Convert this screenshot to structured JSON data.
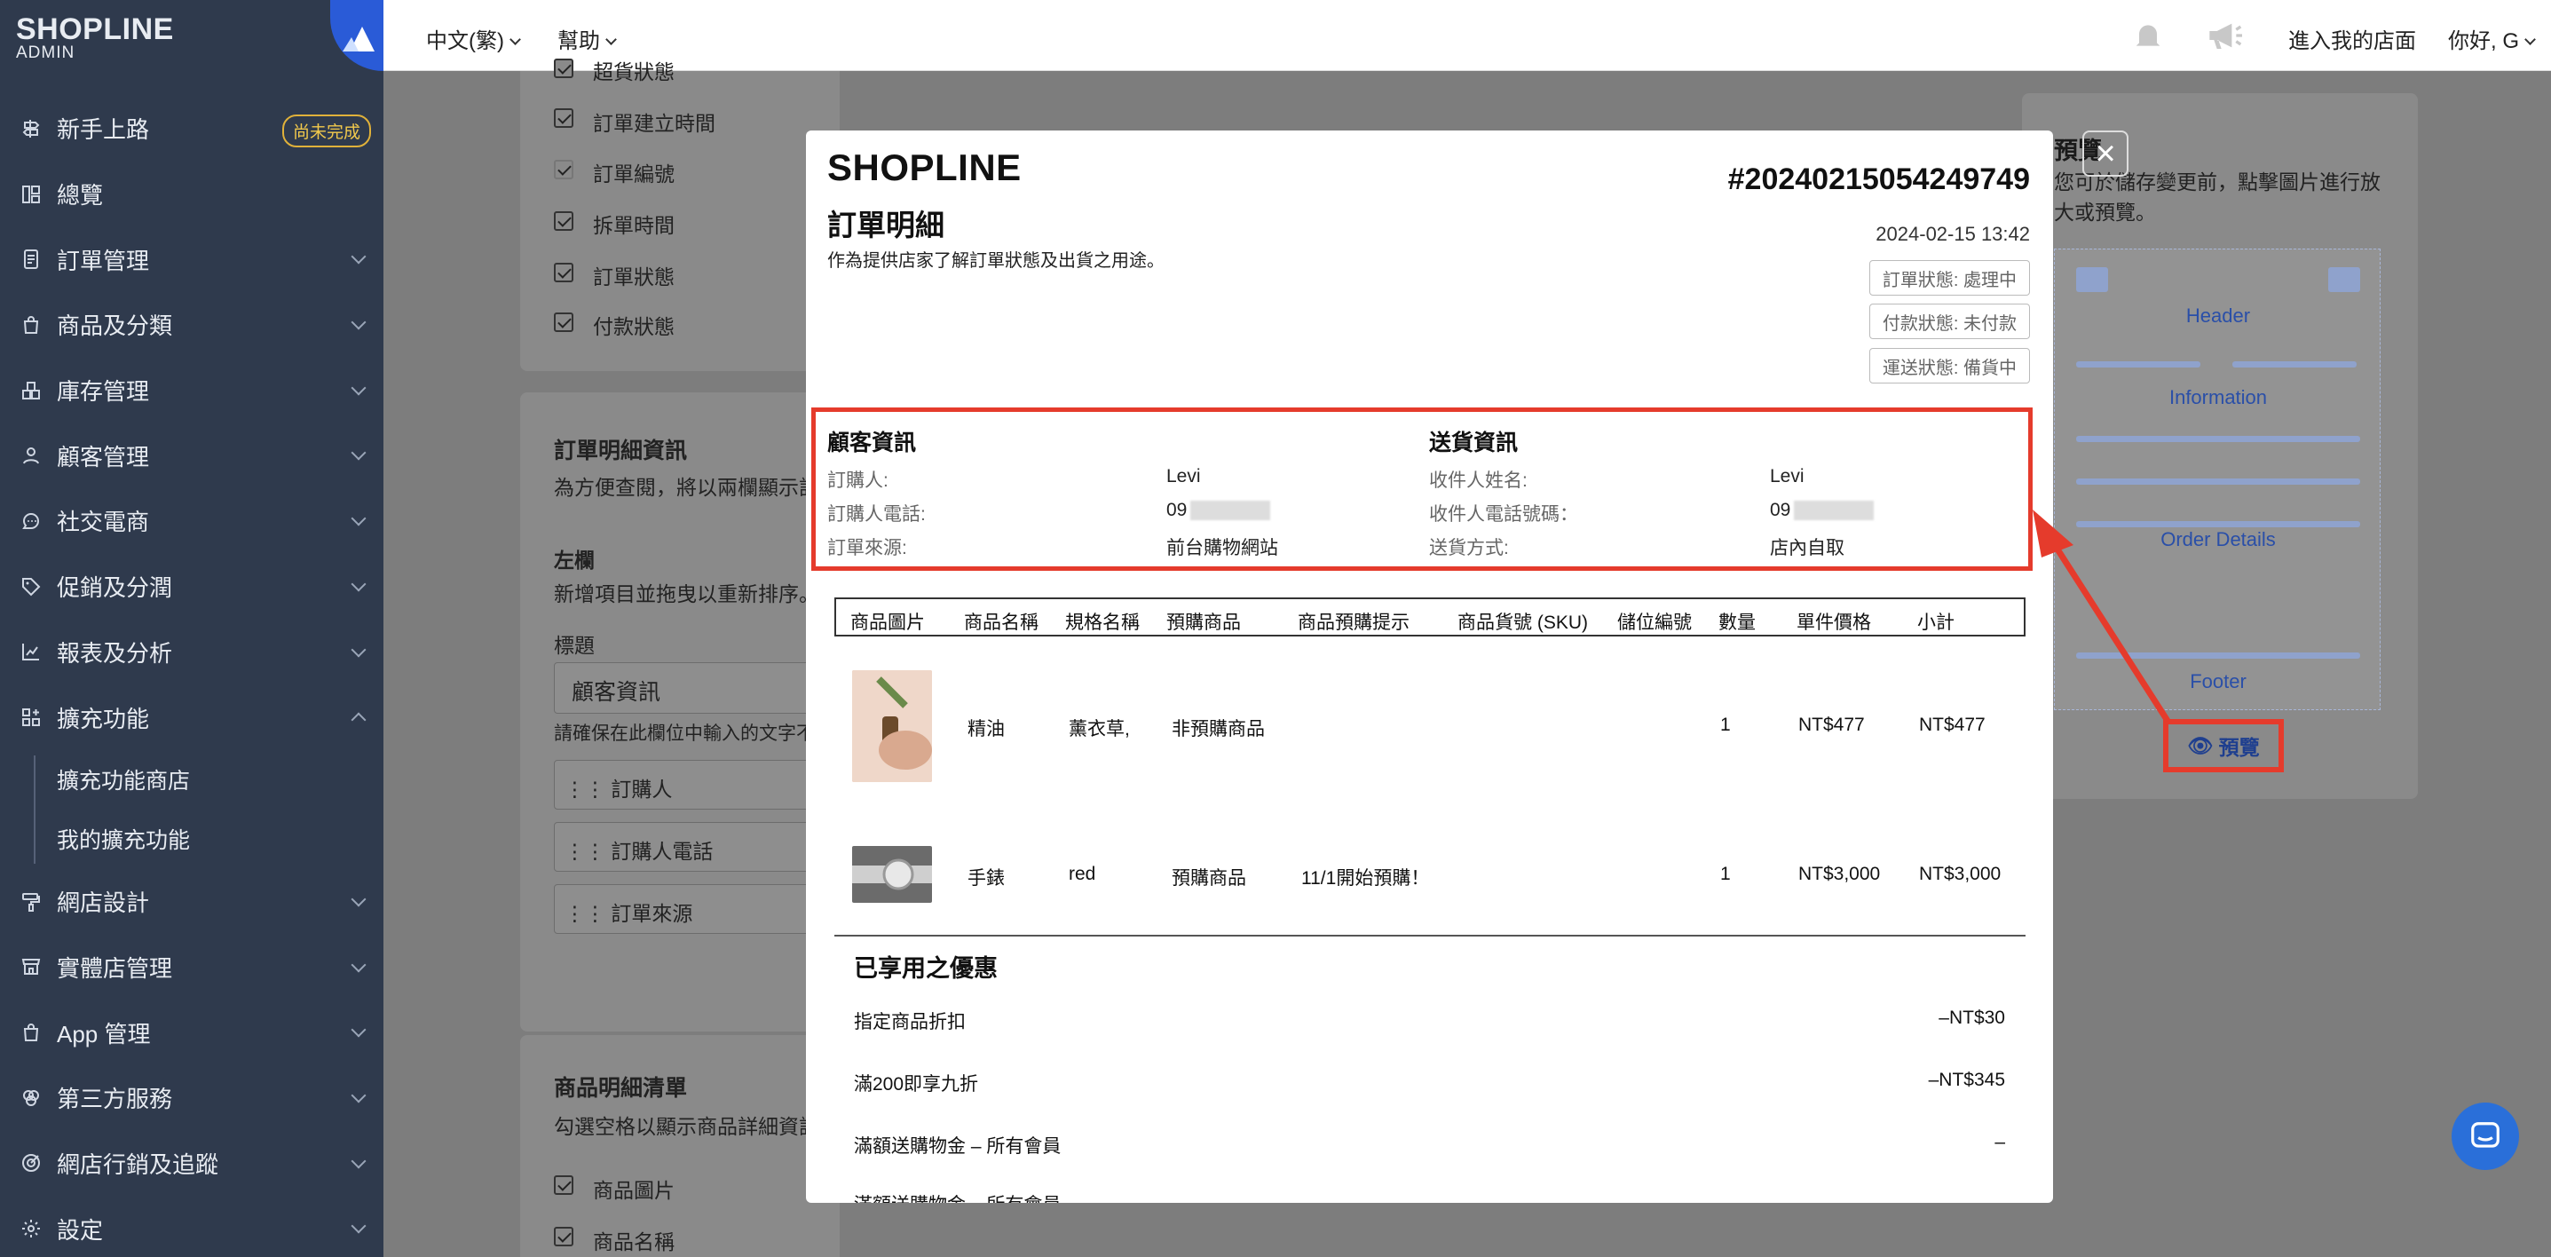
{
  "sidebar": {
    "brand": "SHOPLINE",
    "brand_sub": "ADMIN",
    "items": [
      {
        "label": "新手上路",
        "badge": "尚未完成"
      },
      {
        "label": "總覽"
      },
      {
        "label": "訂單管理"
      },
      {
        "label": "商品及分類"
      },
      {
        "label": "庫存管理"
      },
      {
        "label": "顧客管理"
      },
      {
        "label": "社交電商"
      },
      {
        "label": "促銷及分潤"
      },
      {
        "label": "報表及分析"
      },
      {
        "label": "擴充功能"
      }
    ],
    "subitems": [
      "擴充功能商店",
      "我的擴充功能"
    ],
    "items2": [
      {
        "label": "網店設計"
      },
      {
        "label": "實體店管理"
      },
      {
        "label": "App 管理"
      },
      {
        "label": "第三方服務"
      },
      {
        "label": "網店行銷及追蹤"
      },
      {
        "label": "設定"
      }
    ]
  },
  "topbar": {
    "language": "中文(繁)",
    "help": "幫助",
    "enter_store": "進入我的店面",
    "greeting": "你好, G"
  },
  "background": {
    "checks_top": [
      "超貨狀態",
      "訂單建立時間",
      "訂單編號",
      "拆單時間",
      "訂單狀態",
      "付款狀態"
    ],
    "detail_section_title": "訂單明細資訊",
    "detail_section_desc": "為方便查閱，將以兩欄顯示訂",
    "left_col": "左欄",
    "left_col_desc": "新增項目並拖曳以重新排序。",
    "label_title": "標題",
    "title_value": "顧客資訊",
    "hint": "請確保在此欄位中輸入的文字不",
    "drag_items": [
      "訂購人",
      "訂購人電話",
      "訂單來源"
    ],
    "product_section_title": "商品明細清單",
    "product_section_desc": "勾選空格以顯示商品詳細資訊",
    "product_checks": [
      "商品圖片",
      "商品名稱"
    ]
  },
  "modal": {
    "logo": "SHOPLINE",
    "title": "訂單明細",
    "desc": "作為提供店家了解訂單狀態及出貨之用途。",
    "order_no": "#20240215054249749",
    "date": "2024-02-15 13:42",
    "statuses": [
      "訂單狀態: 處理中",
      "付款狀態: 未付款",
      "運送狀態: 備貨中"
    ],
    "customer": {
      "heading": "顧客資訊",
      "rows": [
        {
          "label": "訂購人:",
          "value": "Levi"
        },
        {
          "label": "訂購人電話:",
          "value": "09"
        },
        {
          "label": "訂單來源:",
          "value": "前台購物網站"
        }
      ]
    },
    "shipping": {
      "heading": "送貨資訊",
      "rows": [
        {
          "label": "收件人姓名:",
          "value": "Levi"
        },
        {
          "label": "收件人電話號碼：",
          "value": "09"
        },
        {
          "label": "送貨方式:",
          "value": "店內自取"
        }
      ]
    },
    "table_headers": [
      "商品圖片",
      "商品名稱",
      "規格名稱",
      "預購商品",
      "商品預購提示",
      "商品貨號 (SKU)",
      "儲位編號",
      "數量",
      "單件價格",
      "小計"
    ],
    "products": [
      {
        "name": "精油",
        "spec": "薰衣草,",
        "preorder": "非預購商品",
        "hint": "",
        "qty": "1",
        "price": "NT$477",
        "subtotal": "NT$477"
      },
      {
        "name": "手錶",
        "spec": "red",
        "preorder": "預購商品",
        "hint": "11/1開始預購！",
        "qty": "1",
        "price": "NT$3,000",
        "subtotal": "NT$3,000"
      }
    ],
    "discount_heading": "已享用之優惠",
    "discounts": [
      {
        "label": "指定商品折扣",
        "value": "–NT$30"
      },
      {
        "label": "滿200即享九折",
        "value": "–NT$345"
      },
      {
        "label": "滿額送購物金 – 所有會員",
        "value": "–"
      },
      {
        "label": "滿額送購物金 – 所有會員",
        "value": ""
      }
    ]
  },
  "preview": {
    "title": "預覽",
    "desc": "您可於儲存變更前，點擊圖片進行放大或預覽。",
    "sections": [
      "Header",
      "Information",
      "Order Details",
      "Footer"
    ],
    "button": "預覽"
  },
  "colors": {
    "sidebar_bg": "#2f3a4d",
    "accent_blue": "#2a5bd7",
    "highlight_red": "#e53b2c",
    "badge_yellow": "#f2c94c"
  }
}
